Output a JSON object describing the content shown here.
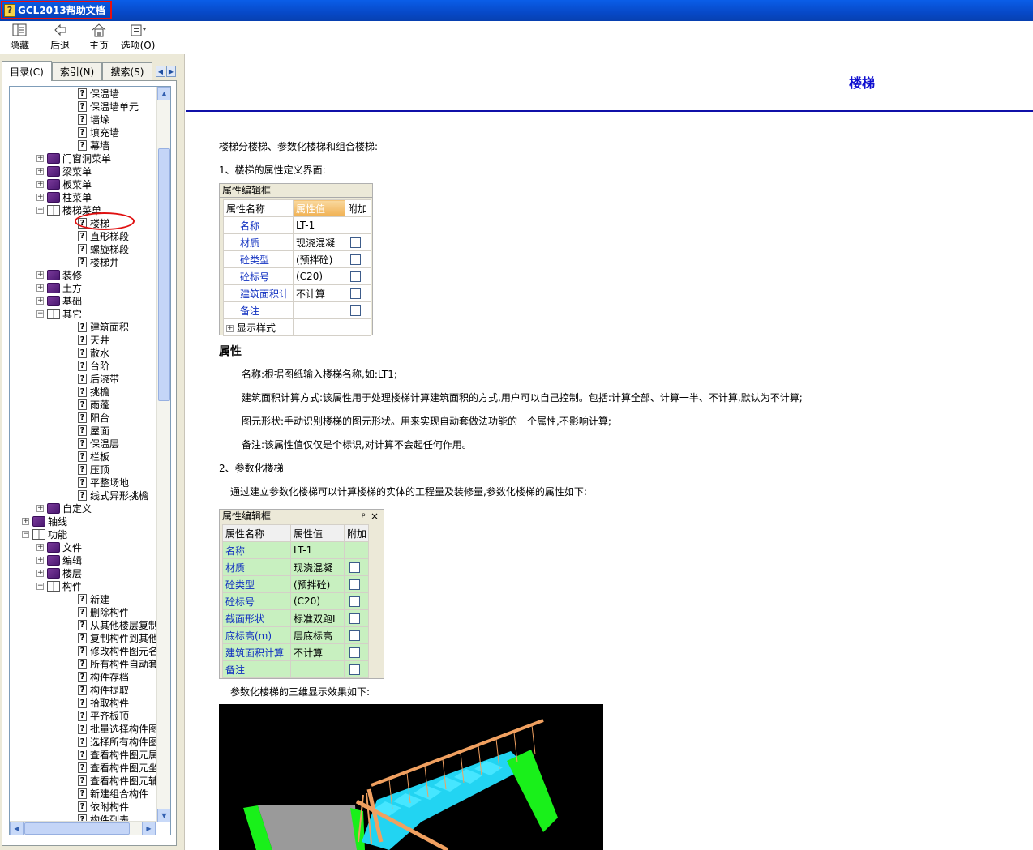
{
  "window": {
    "title": "GCL2013帮助文档"
  },
  "toolbar": {
    "hide": "隐藏",
    "back": "后退",
    "home": "主页",
    "options": "选项(O)"
  },
  "tabs": {
    "contents": "目录(C)",
    "index": "索引(N)",
    "search": "搜索(S)"
  },
  "tree": [
    {
      "label": "保温墙",
      "icon": "topic",
      "level": 3
    },
    {
      "label": "保温墙单元",
      "icon": "topic",
      "level": 3
    },
    {
      "label": "墙垛",
      "icon": "topic",
      "level": 3
    },
    {
      "label": "填充墙",
      "icon": "topic",
      "level": 3
    },
    {
      "label": "幕墙",
      "icon": "topic",
      "level": 3
    },
    {
      "label": "门窗洞菜单",
      "icon": "book",
      "level": 2
    },
    {
      "label": "梁菜单",
      "icon": "book",
      "level": 2
    },
    {
      "label": "板菜单",
      "icon": "book",
      "level": 2
    },
    {
      "label": "柱菜单",
      "icon": "book",
      "level": 2
    },
    {
      "label": "楼梯菜单",
      "icon": "bookopen",
      "level": 2
    },
    {
      "label": "楼梯",
      "icon": "topic",
      "level": 3
    },
    {
      "label": "直形梯段",
      "icon": "topic",
      "level": 3
    },
    {
      "label": "螺旋梯段",
      "icon": "topic",
      "level": 3
    },
    {
      "label": "楼梯井",
      "icon": "topic",
      "level": 3
    },
    {
      "label": "装修",
      "icon": "book",
      "level": 2
    },
    {
      "label": "土方",
      "icon": "book",
      "level": 2
    },
    {
      "label": "基础",
      "icon": "book",
      "level": 2
    },
    {
      "label": "其它",
      "icon": "bookopen",
      "level": 2
    },
    {
      "label": "建筑面积",
      "icon": "topic",
      "level": 3
    },
    {
      "label": "天井",
      "icon": "topic",
      "level": 3
    },
    {
      "label": "散水",
      "icon": "topic",
      "level": 3
    },
    {
      "label": "台阶",
      "icon": "topic",
      "level": 3
    },
    {
      "label": "后浇带",
      "icon": "topic",
      "level": 3
    },
    {
      "label": "挑檐",
      "icon": "topic",
      "level": 3
    },
    {
      "label": "雨蓬",
      "icon": "topic",
      "level": 3
    },
    {
      "label": "阳台",
      "icon": "topic",
      "level": 3
    },
    {
      "label": "屋面",
      "icon": "topic",
      "level": 3
    },
    {
      "label": "保温层",
      "icon": "topic",
      "level": 3
    },
    {
      "label": "栏板",
      "icon": "topic",
      "level": 3
    },
    {
      "label": "压顶",
      "icon": "topic",
      "level": 3
    },
    {
      "label": "平整场地",
      "icon": "topic",
      "level": 3
    },
    {
      "label": "线式异形挑檐",
      "icon": "topic",
      "level": 3
    },
    {
      "label": "自定义",
      "icon": "book",
      "level": 2
    },
    {
      "label": "轴线",
      "icon": "book",
      "level": 1
    },
    {
      "label": "功能",
      "icon": "bookopen",
      "level": 1
    },
    {
      "label": "文件",
      "icon": "book",
      "level": 2
    },
    {
      "label": "编辑",
      "icon": "book",
      "level": 2
    },
    {
      "label": "楼层",
      "icon": "book",
      "level": 2
    },
    {
      "label": "构件",
      "icon": "bookopen",
      "level": 2
    },
    {
      "label": "新建",
      "icon": "topic",
      "level": 3
    },
    {
      "label": "删除构件",
      "icon": "topic",
      "level": 3
    },
    {
      "label": "从其他楼层复制",
      "icon": "topic",
      "level": 3
    },
    {
      "label": "复制构件到其他",
      "icon": "topic",
      "level": 3
    },
    {
      "label": "修改构件图元名",
      "icon": "topic",
      "level": 3
    },
    {
      "label": "所有构件自动套",
      "icon": "topic",
      "level": 3
    },
    {
      "label": "构件存档",
      "icon": "topic",
      "level": 3
    },
    {
      "label": "构件提取",
      "icon": "topic",
      "level": 3
    },
    {
      "label": "拾取构件",
      "icon": "topic",
      "level": 3
    },
    {
      "label": "平齐板顶",
      "icon": "topic",
      "level": 3
    },
    {
      "label": "批量选择构件图",
      "icon": "topic",
      "level": 3
    },
    {
      "label": "选择所有构件图",
      "icon": "topic",
      "level": 3
    },
    {
      "label": "查看构件图元属",
      "icon": "topic",
      "level": 3
    },
    {
      "label": "查看构件图元坐",
      "icon": "topic",
      "level": 3
    },
    {
      "label": "查看构件图元辅",
      "icon": "topic",
      "level": 3
    },
    {
      "label": "新建组合构件",
      "icon": "topic",
      "level": 3
    },
    {
      "label": "依附构件",
      "icon": "topic",
      "level": 3
    },
    {
      "label": "构件列表",
      "icon": "topic",
      "level": 3
    }
  ],
  "content": {
    "heading": "楼梯",
    "intro": "楼梯分楼梯、参数化楼梯和组合楼梯:",
    "sec1": "1、楼梯的属性定义界面:",
    "grid1": {
      "title": "属性编辑框",
      "headers": [
        "属性名称",
        "属性值",
        "附加"
      ],
      "rows": [
        {
          "name": "名称",
          "value": "LT-1",
          "check": false
        },
        {
          "name": "材质",
          "value": "现浇混凝",
          "check": true
        },
        {
          "name": "砼类型",
          "value": "(预拌砼)",
          "check": true
        },
        {
          "name": "砼标号",
          "value": "(C20)",
          "check": true
        },
        {
          "name": "建筑面积计",
          "value": "不计算",
          "check": true
        },
        {
          "name": "备注",
          "value": "",
          "check": true
        }
      ],
      "footer": "显示样式"
    },
    "attr_heading": "属性",
    "desc": [
      "名称:根据图纸输入楼梯名称,如:LT1;",
      "建筑面积计算方式:该属性用于处理楼梯计算建筑面积的方式,用户可以自己控制。包括:计算全部、计算一半、不计算,默认为不计算;",
      "图元形状:手动识别楼梯的图元形状。用来实现自动套做法功能的一个属性,不影响计算;",
      "备注:该属性值仅仅是个标识,对计算不会起任何作用。"
    ],
    "sec2": "2、参数化楼梯",
    "sec2_desc": "通过建立参数化楼梯可以计算楼梯的实体的工程量及装修量,参数化楼梯的属性如下:",
    "grid2": {
      "title": "属性编辑框",
      "pin": "ᵖ",
      "close": "×",
      "headers": [
        "属性名称",
        "属性值",
        "附加"
      ],
      "rows": [
        {
          "name": "名称",
          "value": "LT-1",
          "check": false
        },
        {
          "name": "材质",
          "value": "现浇混凝",
          "check": true
        },
        {
          "name": "砼类型",
          "value": "(预拌砼)",
          "check": true
        },
        {
          "name": "砼标号",
          "value": "(C20)",
          "check": true
        },
        {
          "name": "截面形状",
          "value": "标准双跑I",
          "check": true
        },
        {
          "name": "底标高(m)",
          "value": "层底标高",
          "check": true
        },
        {
          "name": "建筑面积计算",
          "value": "不计算",
          "check": true
        },
        {
          "name": "备注",
          "value": "",
          "check": true
        }
      ]
    },
    "img_caption": "参数化楼梯的三维显示效果如下:"
  },
  "colors": {
    "titlebar": "#0749c8",
    "heading": "#1010d0",
    "highlight_red": "#e01010",
    "grid2_bg": "#c8f0c0"
  }
}
